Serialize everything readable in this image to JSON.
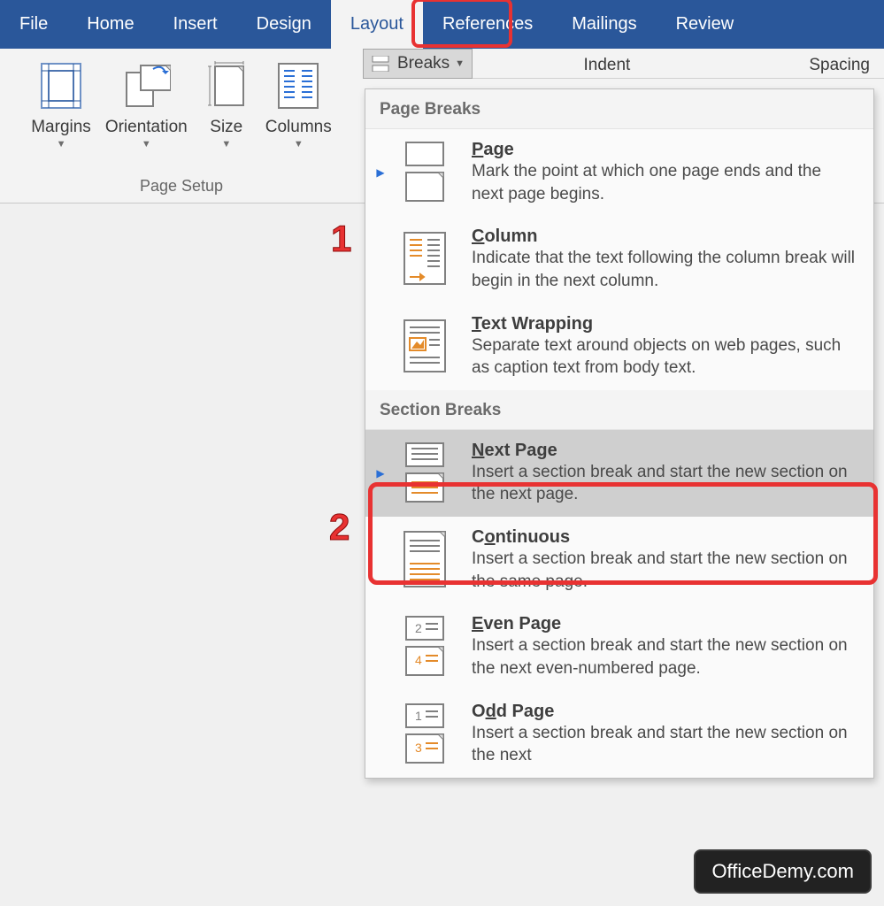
{
  "ribbon": {
    "tabs": [
      "File",
      "Home",
      "Insert",
      "Design",
      "Layout",
      "References",
      "Mailings",
      "Review"
    ],
    "active_tab_index": 4
  },
  "page_setup": {
    "group_label": "Page Setup",
    "buttons": [
      {
        "label": "Margins"
      },
      {
        "label": "Orientation"
      },
      {
        "label": "Size"
      },
      {
        "label": "Columns"
      }
    ]
  },
  "breaks_button_label": "Breaks",
  "header_labels": {
    "indent": "Indent",
    "spacing": "Spacing"
  },
  "callouts": [
    "1",
    "2"
  ],
  "dropdown": {
    "sections": [
      {
        "title": "Page Breaks",
        "items": [
          {
            "accel": "P",
            "title_rest": "age",
            "desc": "Mark the point at which one page ends and the next page begins."
          },
          {
            "accel": "C",
            "title_rest": "olumn",
            "desc": "Indicate that the text following the column break will begin in the next column."
          },
          {
            "accel": "T",
            "title_rest": "ext Wrapping",
            "desc": "Separate text around objects on web pages, such as caption text from body text."
          }
        ]
      },
      {
        "title": "Section Breaks",
        "items": [
          {
            "accel": "N",
            "title_rest": "ext Page",
            "desc": "Insert a section break and start the new section on the next page.",
            "selected": true
          },
          {
            "title_pre": "C",
            "accel": "o",
            "title_rest": "ntinuous",
            "desc": "Insert a section break and start the new section on the same page."
          },
          {
            "accel": "E",
            "title_rest": "ven Page",
            "desc": "Insert a section break and start the new section on the next even-numbered page."
          },
          {
            "title_pre": "O",
            "accel": "d",
            "title_rest": "d Page",
            "desc": "Insert a section break and start the new section on the next"
          }
        ]
      }
    ]
  },
  "brand": "OfficeDemy.com"
}
